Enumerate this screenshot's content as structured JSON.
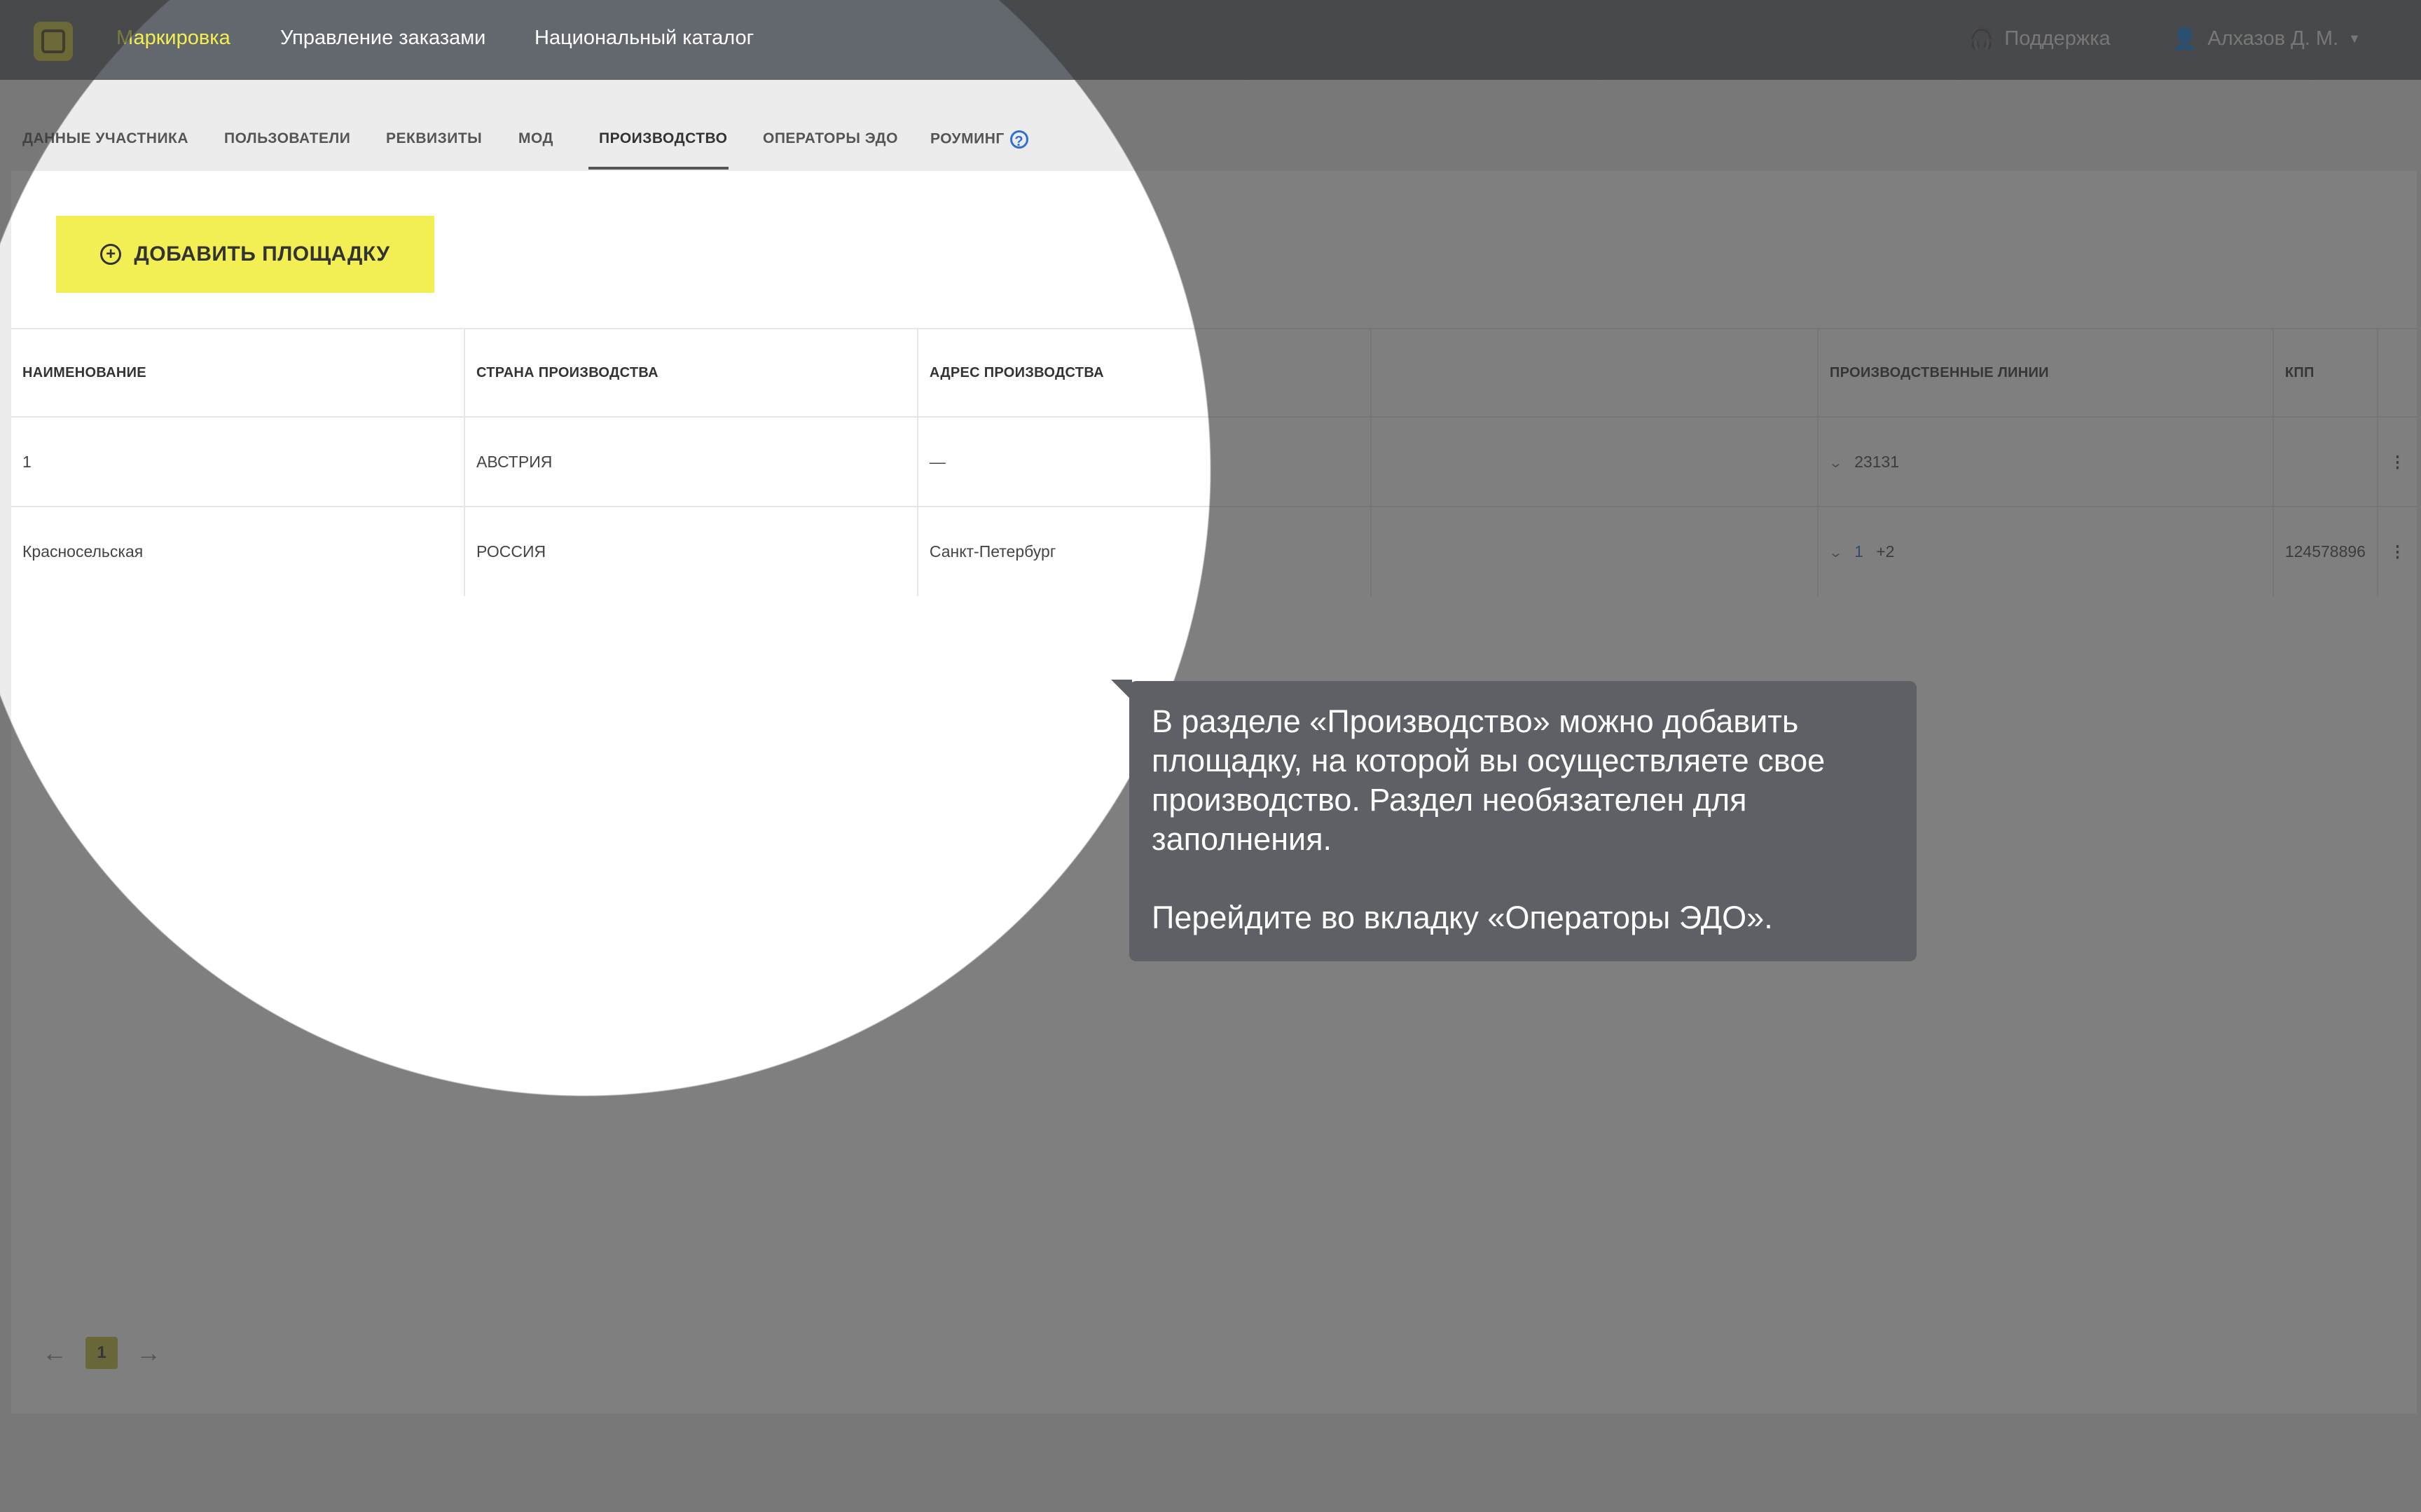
{
  "header": {
    "nav": [
      "Маркировка",
      "Управление заказами",
      "Национальный каталог"
    ],
    "support_label": "Поддержка",
    "user_label": "Алхазов Д. М."
  },
  "tabs": [
    {
      "label": "ДАННЫЕ УЧАСТНИКА"
    },
    {
      "label": "ПОЛЬЗОВАТЕЛИ"
    },
    {
      "label": "РЕКВИЗИТЫ"
    },
    {
      "label": "МОД"
    },
    {
      "label": "ПРОИЗВОДСТВО"
    },
    {
      "label": "ОПЕРАТОРЫ ЭДО"
    },
    {
      "label": "РОУМИНГ"
    }
  ],
  "add_button_label": "ДОБАВИТЬ ПЛОЩАДКУ",
  "table": {
    "columns": [
      "НАИМЕНОВАНИЕ",
      "СТРАНА ПРОИЗВОДСТВА",
      "АДРЕС ПРОИЗВОДСТВА",
      "",
      "ПРОИЗВОДСТВЕННЫЕ ЛИНИИ",
      "КПП"
    ],
    "rows": [
      {
        "name": "1",
        "country": "АВСТРИЯ",
        "address": "—",
        "lines_main": "23131",
        "lines_more": "",
        "kpp": ""
      },
      {
        "name": "Красносельская",
        "country": "РОССИЯ",
        "address": "Санкт-Петербург",
        "lines_main": "1",
        "lines_more": "+2",
        "kpp": "124578896"
      }
    ]
  },
  "pagination": {
    "current": "1"
  },
  "tooltip": {
    "text1": "В разделе «Производство» можно добавить площадку, на которой вы осуществляете свое производство. Раздел необязателен для заполнения.",
    "text2": "Перейдите во вкладку «Операторы ЭДО»."
  },
  "colors": {
    "accent": "#f2ef55",
    "topbar": "#63686e",
    "link": "#2d6fd6"
  }
}
